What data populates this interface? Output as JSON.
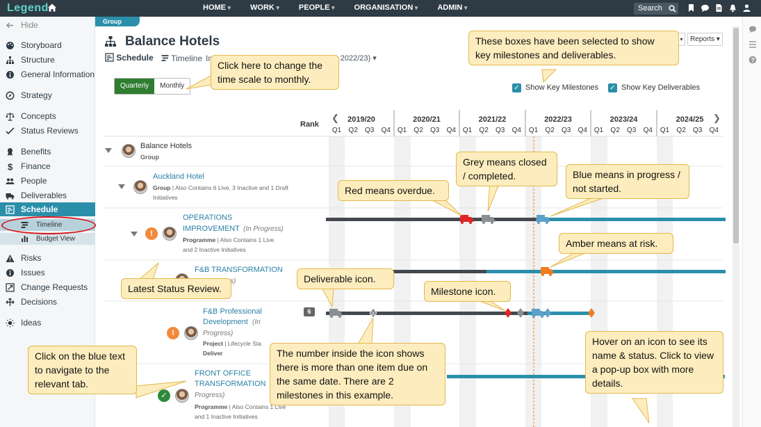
{
  "topbar": {
    "logo": "Legend",
    "nav": [
      "HOME",
      "WORK",
      "PEOPLE",
      "ORGANISATION",
      "ADMIN"
    ],
    "search_label": "Search",
    "icons": [
      "search-icon",
      "bookmark-icon",
      "chat-icon",
      "document-icon",
      "bell-icon",
      "user-icon"
    ]
  },
  "sidebar": {
    "hide": "Hide",
    "items": [
      {
        "label": "Storyboard",
        "icon": "palette-icon"
      },
      {
        "label": "Structure",
        "icon": "structure-icon"
      },
      {
        "label": "General Information",
        "icon": "info-icon"
      },
      {
        "label": "Strategy",
        "icon": "compass-icon"
      },
      {
        "label": "Concepts",
        "icon": "scales-icon"
      },
      {
        "label": "Status Reviews",
        "icon": "check-trend-icon"
      },
      {
        "label": "Benefits",
        "icon": "ribbon-icon"
      },
      {
        "label": "Finance",
        "icon": "dollar-icon"
      },
      {
        "label": "People",
        "icon": "people-icon"
      },
      {
        "label": "Deliverables",
        "icon": "truck-icon"
      },
      {
        "label": "Schedule",
        "icon": "schedule-icon"
      },
      {
        "label": "Risks",
        "icon": "warning-icon"
      },
      {
        "label": "Issues",
        "icon": "info-icon"
      },
      {
        "label": "Change Requests",
        "icon": "change-icon"
      },
      {
        "label": "Decisions",
        "icon": "decision-icon"
      },
      {
        "label": "Ideas",
        "icon": "lightbulb-icon"
      }
    ],
    "schedule_sub": [
      "Timeline",
      "Budget View"
    ]
  },
  "header": {
    "group_tab": "Group",
    "title": "Balance Hotels",
    "tab_schedule": "Schedule",
    "tab_timeline": "Timeline",
    "tab_fragment_left": "In",
    "tab_fragment_right": "- 2022/23)",
    "reports": "Reports"
  },
  "controls": {
    "quarterly": "Quarterly",
    "monthly": "Monthly",
    "show_key_milestones": "Show Key Milestones",
    "show_key_deliverables": "Show Key Deliverables"
  },
  "timeline": {
    "rank_label": "Rank",
    "years": [
      "2019/20",
      "2020/21",
      "2021/22",
      "2022/23",
      "2023/24",
      "2024/25"
    ],
    "quarters": [
      "Q1",
      "Q2",
      "Q3",
      "Q4"
    ],
    "colors": {
      "closed": "#555b63",
      "in_progress": "#2b8faa",
      "overdue": "#e02424",
      "at_risk": "#f07c1f",
      "completed_icon": "#8a8f94"
    }
  },
  "rows": [
    {
      "name": "Balance Hotels",
      "type": "Group"
    },
    {
      "name": "Auckland Hotel",
      "type": "Group",
      "contains": "Also Contains 6 Live, 3 Inactive and 1 Draft Initiatives"
    },
    {
      "name_line1": "OPERATIONS",
      "name_line2": "IMPROVEMENT",
      "status": "(In Progress)",
      "type": "Programme",
      "contains_line1": "Also Contains 1 Live",
      "contains_line2": "and 2 Inactive Initiatives"
    },
    {
      "name": "F&B TRANSFORMATION",
      "status_fragment": "s)"
    },
    {
      "name_line1": "F&B Professional",
      "name_line2": "Development",
      "status_line1": "(In",
      "status_line2": "Progress)",
      "type": "Project",
      "extra": "Lifecycle Sta",
      "stage": "Deliver",
      "rank": "6"
    },
    {
      "name_line1": "FRONT OFFICE",
      "name_line2": "TRANSFORMATION",
      "status": "(In",
      "status_line2": "Progress)",
      "type": "Programme",
      "contains_line1": "Also Contains 1 Live",
      "contains_line2": "and 1 Inactive Initiatives"
    }
  ],
  "callouts": {
    "monthly": "Click here to change the time scale to monthly.",
    "key_boxes": "These boxes have been selected to show key milestones and deliverables.",
    "grey": "Grey means closed / completed.",
    "blue": "Blue means in progress / not started.",
    "red": "Red means overdue.",
    "amber": "Amber means at risk.",
    "deliverable": "Deliverable icon.",
    "milestone": "Milestone icon.",
    "status_review": "Latest Status Review.",
    "number": "The number inside the icon shows there is more than one item due on the same date.  There are 2 milestones in this example.",
    "hover": "Hover on an icon to see its name & status. Click to view a pop-up box with more details.",
    "blue_text": "Click on the blue text to navigate to the relevant tab."
  }
}
